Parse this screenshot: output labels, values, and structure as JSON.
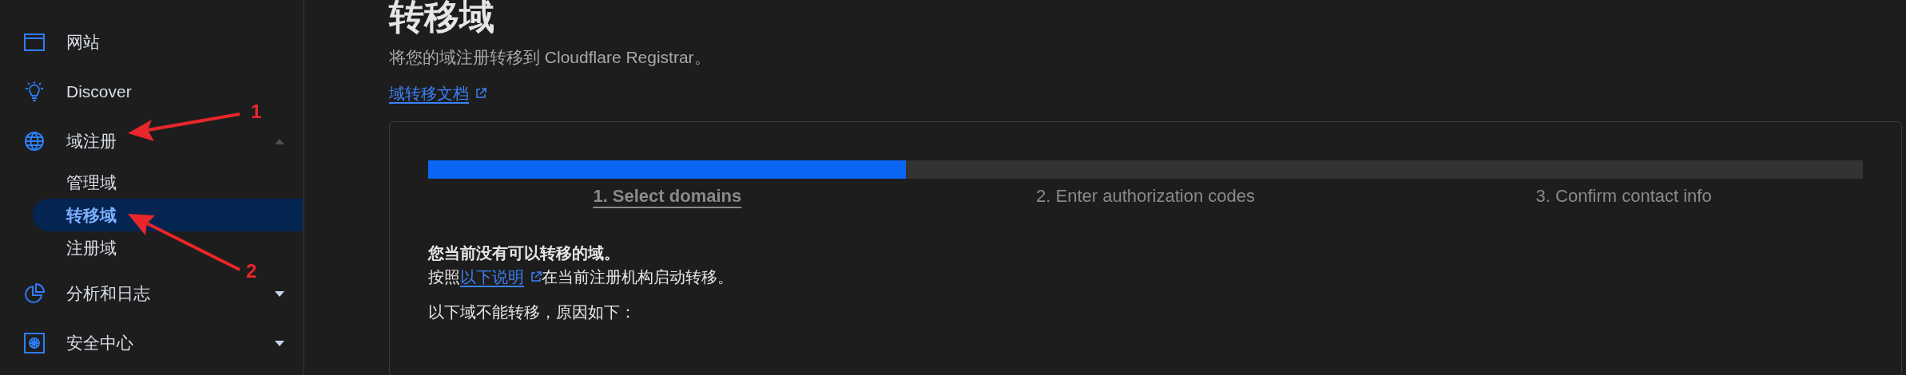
{
  "sidebar": {
    "items": [
      {
        "label": "网站"
      },
      {
        "label": "Discover"
      },
      {
        "label": "域注册",
        "expanded": true,
        "children": [
          {
            "label": "管理域",
            "selected": false
          },
          {
            "label": "转移域",
            "selected": true
          },
          {
            "label": "注册域",
            "selected": false
          }
        ]
      },
      {
        "label": "分析和日志",
        "expanded": false
      },
      {
        "label": "安全中心",
        "expanded": false
      }
    ]
  },
  "page": {
    "title": "转移域",
    "subtitle": "将您的域注册转移到 Cloudflare Registrar。",
    "doc_link": "域转移文档"
  },
  "wizard": {
    "progress": {
      "level": 0.333
    },
    "steps": [
      {
        "label": "1. Select domains",
        "selected": true
      },
      {
        "label": "2. Enter authorization codes",
        "selected": false
      },
      {
        "label": "3. Confirm contact info",
        "selected": false
      }
    ],
    "notice": "您当前没有可以转移的域。",
    "instruction": {
      "before": "按照",
      "link": "以下说明",
      "after": "在当前注册机构启动转移。"
    },
    "reasons_heading": "以下域不能转移，原因如下："
  },
  "annotations": [
    {
      "label": "1"
    },
    {
      "label": "2"
    }
  ]
}
